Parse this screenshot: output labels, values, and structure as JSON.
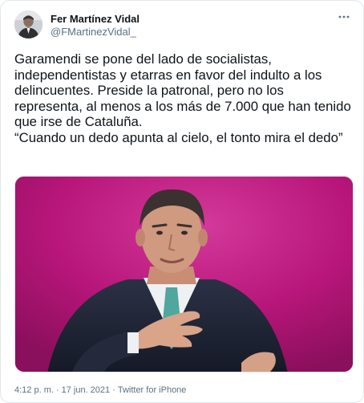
{
  "author": {
    "name": "Fer Martínez Vidal",
    "handle": "@FMartinezVidal_"
  },
  "tweet": {
    "text": "Garamendi se pone del lado de socialistas, independentistas y etarras en favor del indulto a los delincuentes. Preside la patronal, pero no los representa, al menos a los más de 7.000 que han tenido que irse de Cataluña.\n“Cuando un dedo apunta al cielo, el tonto mira el dedo”",
    "time": "4:12 p. m.",
    "separator": "·",
    "date": "17 jun. 2021",
    "source": "Twitter for iPhone"
  },
  "icons": {
    "more": "more-horizontal-icon"
  },
  "colors": {
    "text": "#0f1419",
    "secondary_text": "#5b7083",
    "border": "#e1e8ed",
    "media_background": "#b8167a"
  }
}
